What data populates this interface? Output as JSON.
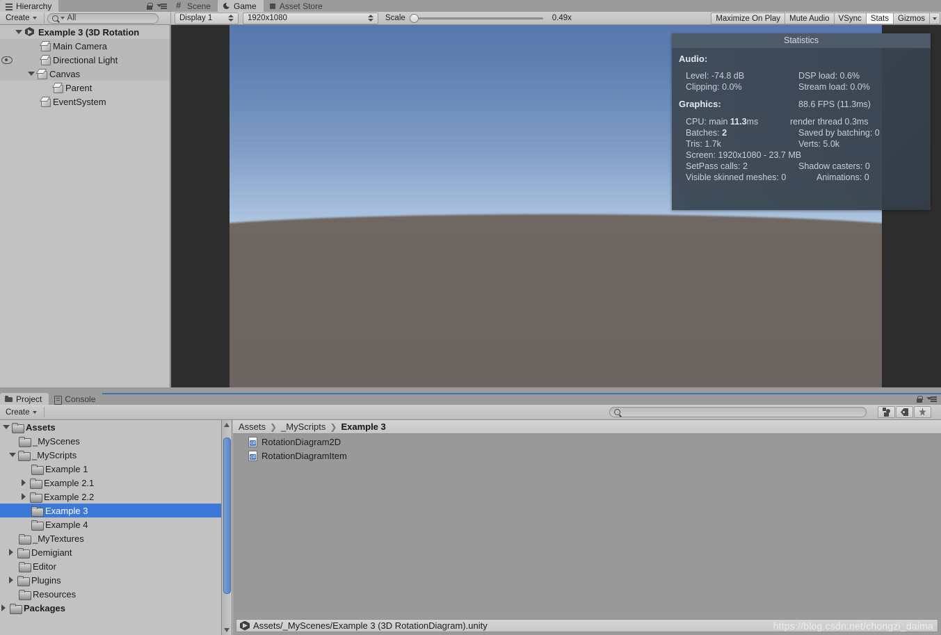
{
  "hierarchy": {
    "tabs": [
      {
        "label": "Hierarchy",
        "icon": "hierarchy-icon",
        "active": true
      }
    ],
    "create_button": "Create",
    "search_placeholder": "All",
    "search_value": "",
    "items": [
      {
        "label": "Example 3 (3D RotationDiagram).unity",
        "display": "Example 3 (3D Rotation",
        "icon": "unity-scene-icon",
        "indent": 0,
        "twisty": "expanded",
        "bold": true,
        "alt": false,
        "eye": false
      },
      {
        "label": "Main Camera",
        "icon": "gameobject-cube-icon",
        "indent": 1,
        "twisty": "none",
        "bold": false,
        "alt": true,
        "eye": false
      },
      {
        "label": "Directional Light",
        "icon": "gameobject-cube-icon",
        "indent": 1,
        "twisty": "none",
        "bold": false,
        "alt": true,
        "eye": true
      },
      {
        "label": "Canvas",
        "icon": "gameobject-cube-icon",
        "indent": 1,
        "twisty": "expanded",
        "bold": false,
        "alt": true,
        "eye": false
      },
      {
        "label": "Parent",
        "icon": "gameobject-cube-icon",
        "indent": 2,
        "twisty": "none",
        "bold": false,
        "alt": false,
        "eye": false
      },
      {
        "label": "EventSystem",
        "icon": "gameobject-cube-icon",
        "indent": 1,
        "twisty": "none",
        "bold": false,
        "alt": false,
        "eye": false
      }
    ]
  },
  "viewtabs": [
    {
      "label": "Scene",
      "icon": "scene-icon",
      "active": false
    },
    {
      "label": "Game",
      "icon": "game-icon",
      "active": true
    },
    {
      "label": "Asset Store",
      "icon": "asset-store-icon",
      "active": false
    }
  ],
  "game_toolbar": {
    "display": "Display 1",
    "resolution": "1920x1080",
    "scale_label": "Scale",
    "scale_value": "0.49x",
    "maximize_on_play": "Maximize On Play",
    "mute_audio": "Mute Audio",
    "vsync": "VSync",
    "stats": "Stats",
    "stats_active": true,
    "gizmos": "Gizmos"
  },
  "statistics": {
    "title": "Statistics",
    "audio_head": "Audio:",
    "audio": [
      {
        "left": "Level: -74.8 dB",
        "right": "DSP load: 0.6%"
      },
      {
        "left": "Clipping: 0.0%",
        "right": "Stream load: 0.0%"
      }
    ],
    "graphics_head": "Graphics:",
    "fps": "88.6 FPS (11.3ms)",
    "graphics": [
      {
        "left_pre": "CPU: main ",
        "left_bold": "11.3",
        "left_post": "ms",
        "right": "render thread 0.3ms"
      },
      {
        "left_pre": "Batches: ",
        "left_bold": "2",
        "left_post": "",
        "right": "Saved by batching: 0"
      },
      {
        "left_pre": "Tris: 1.7k",
        "left_bold": "",
        "left_post": "",
        "right": "Verts: 5.0k"
      },
      {
        "left_pre": "Screen: 1920x1080 - 23.7 MB",
        "left_bold": "",
        "left_post": "",
        "right": ""
      },
      {
        "left_pre": "SetPass calls: 2",
        "left_bold": "",
        "left_post": "",
        "right": "Shadow casters: 0"
      },
      {
        "left_pre": "Visible skinned meshes: 0",
        "left_bold": "",
        "left_post": "",
        "right": "Animations: 0"
      }
    ]
  },
  "project": {
    "tabs": [
      {
        "label": "Project",
        "icon": "project-folder-icon",
        "active": true
      },
      {
        "label": "Console",
        "icon": "console-icon",
        "active": false
      }
    ],
    "create_button": "Create",
    "search_placeholder": "",
    "search_value": "",
    "filter_icons": [
      "asset-type-filter-icon",
      "label-filter-icon",
      "favorites-star-icon"
    ],
    "tree": [
      {
        "label": "Assets",
        "indent": 0,
        "twisty": "expanded",
        "bold": true,
        "selected": false
      },
      {
        "label": "_MyScenes",
        "indent": 1,
        "twisty": "none",
        "bold": false,
        "selected": false
      },
      {
        "label": "_MyScripts",
        "indent": 1,
        "twisty": "expanded",
        "bold": false,
        "selected": false
      },
      {
        "label": "Example 1",
        "indent": 2,
        "twisty": "none",
        "bold": false,
        "selected": false
      },
      {
        "label": "Example 2.1",
        "indent": 2,
        "twisty": "collapsed",
        "bold": false,
        "selected": false
      },
      {
        "label": "Example 2.2",
        "indent": 2,
        "twisty": "collapsed",
        "bold": false,
        "selected": false
      },
      {
        "label": "Example 3",
        "indent": 2,
        "twisty": "none",
        "bold": false,
        "selected": true
      },
      {
        "label": "Example 4",
        "indent": 2,
        "twisty": "none",
        "bold": false,
        "selected": false
      },
      {
        "label": "_MyTextures",
        "indent": 1,
        "twisty": "none",
        "bold": false,
        "selected": false
      },
      {
        "label": "Demigiant",
        "indent": 1,
        "twisty": "collapsed",
        "bold": false,
        "selected": false
      },
      {
        "label": "Editor",
        "indent": 1,
        "twisty": "none",
        "bold": false,
        "selected": false
      },
      {
        "label": "Plugins",
        "indent": 1,
        "twisty": "collapsed",
        "bold": false,
        "selected": false
      },
      {
        "label": "Resources",
        "indent": 1,
        "twisty": "none",
        "bold": false,
        "selected": false
      },
      {
        "label": "Packages",
        "indent": 0,
        "twisty": "collapsed",
        "bold": true,
        "selected": false
      }
    ],
    "breadcrumb": [
      "Assets",
      "_MyScripts",
      "Example 3"
    ],
    "assets": [
      {
        "label": "RotationDiagram2D",
        "icon": "csharp-script-icon"
      },
      {
        "label": "RotationDiagramItem",
        "icon": "csharp-script-icon"
      }
    ]
  },
  "statusbar": {
    "path": "Assets/_MyScenes/Example 3 (3D RotationDiagram).unity",
    "watermark": "https://blog.csdn.net/chongzi_daima"
  },
  "colors": {
    "selection_blue": "#3b78d8",
    "panel_bg": "#c2c2c2",
    "tabbar_bg": "#9b9b9b",
    "stats_bg": "#3e4955",
    "sky_top": "#5878ad",
    "sky_horizon": "#f2fcff",
    "ground": "#6d6561",
    "letterbox": "#2d2d2d"
  }
}
